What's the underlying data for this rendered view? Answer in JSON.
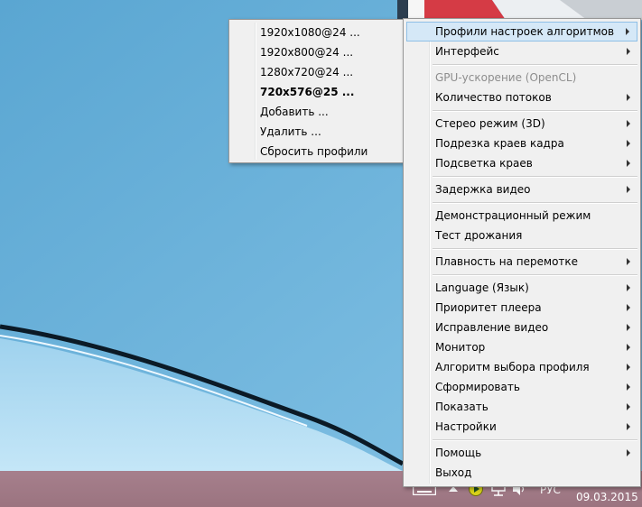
{
  "submenu": {
    "items": [
      {
        "label": "1920x1080@24 ...",
        "bold": false
      },
      {
        "label": "1920x800@24 ...",
        "bold": false
      },
      {
        "label": "1280x720@24 ...",
        "bold": false
      },
      {
        "label": "720x576@25 ...",
        "bold": true
      },
      {
        "label": "Добавить ...",
        "bold": false
      },
      {
        "label": "Удалить ...",
        "bold": false
      },
      {
        "label": "Сбросить профили",
        "bold": false
      }
    ]
  },
  "main_menu": {
    "items": [
      {
        "label": "Профили настроек алгоритмов",
        "submenu": true,
        "highlighted": true,
        "disabled": false
      },
      {
        "label": "Интерфейс",
        "submenu": true
      },
      {
        "label": "GPU-ускорение (OpenCL)",
        "submenu": false,
        "disabled": true
      },
      {
        "label": "Количество потоков",
        "submenu": true
      },
      {
        "label": "Стерео режим (3D)",
        "submenu": true
      },
      {
        "label": "Подрезка краев кадра",
        "submenu": true
      },
      {
        "label": "Подсветка краев",
        "submenu": true
      },
      {
        "label": "Задержка видео",
        "submenu": true
      },
      {
        "label": "Демонстрационный режим",
        "submenu": false
      },
      {
        "label": "Тест дрожания",
        "submenu": false
      },
      {
        "label": "Плавность на перемотке",
        "submenu": true
      },
      {
        "label": "Language (Язык)",
        "submenu": true
      },
      {
        "label": "Приоритет плеера",
        "submenu": true
      },
      {
        "label": "Исправление видео",
        "submenu": true
      },
      {
        "label": "Монитор",
        "submenu": true
      },
      {
        "label": "Алгоритм выбора профиля",
        "submenu": true
      },
      {
        "label": "Сформировать",
        "submenu": true
      },
      {
        "label": "Показать",
        "submenu": true
      },
      {
        "label": "Настройки",
        "submenu": true
      },
      {
        "label": "Помощь",
        "submenu": true
      },
      {
        "label": "Выход",
        "submenu": false
      }
    ]
  },
  "taskbar": {
    "language": "РУС",
    "date": "09.03.2015",
    "icons": [
      "keyboard-icon",
      "tray-expand-icon",
      "player-icon",
      "network-icon",
      "volume-icon"
    ]
  },
  "colors": {
    "menu_bg": "#f0f0f0",
    "highlight_bg": "#d5e8f7",
    "highlight_border": "#8fbfe6",
    "taskbar": "#a67f8c",
    "desktop": "#6fb4da"
  }
}
